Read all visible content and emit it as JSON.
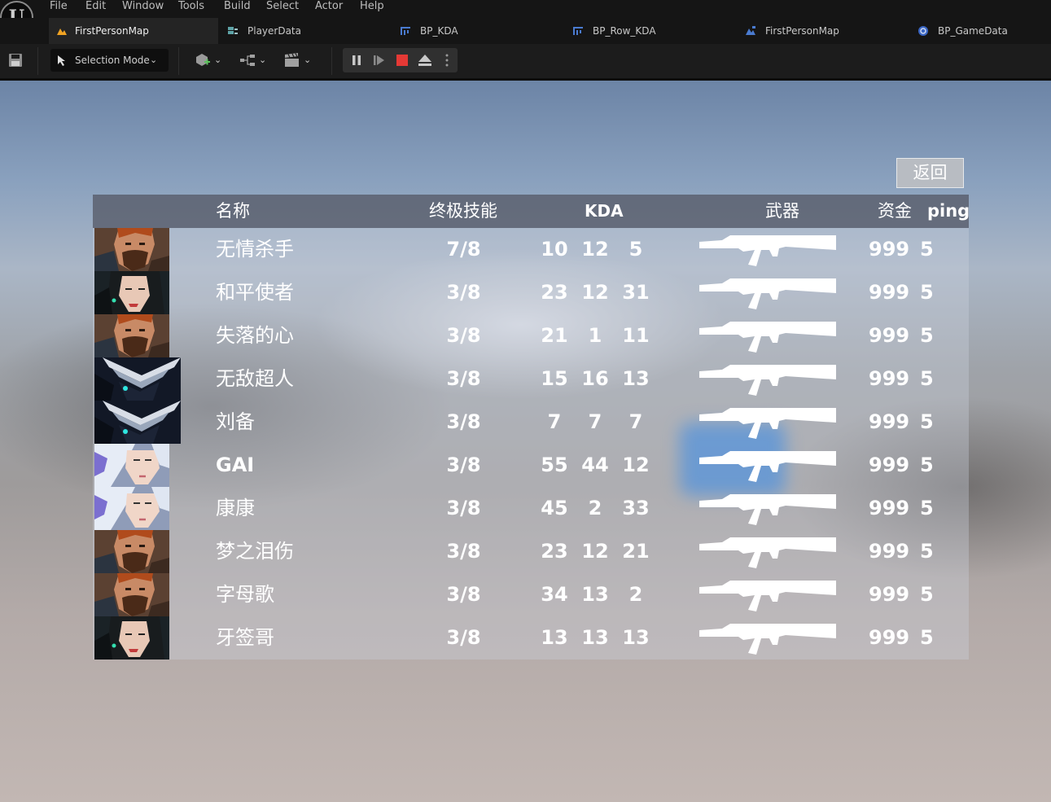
{
  "app": {
    "logo": "U",
    "menu": [
      "File",
      "Edit",
      "Window",
      "Tools",
      "Build",
      "Select",
      "Actor",
      "Help"
    ],
    "tabs": [
      {
        "label": "FirstPersonMap",
        "icon": "level-icon",
        "active": true
      },
      {
        "label": "PlayerData",
        "icon": "data-table-icon",
        "active": false
      },
      {
        "label": "BP_KDA",
        "icon": "widget-blueprint-icon",
        "active": false
      },
      {
        "label": "BP_Row_KDA",
        "icon": "widget-blueprint-icon",
        "active": false
      },
      {
        "label": "FirstPersonMap",
        "icon": "level-blueprint-icon",
        "active": false
      },
      {
        "label": "BP_GameData",
        "icon": "blueprint-icon",
        "active": false
      }
    ],
    "toolbar": {
      "selection_mode": "Selection Mode",
      "icons": [
        "save-icon",
        "add-actor-icon",
        "blueprint-options-icon",
        "cinematics-icon",
        "pause-icon",
        "step-frame-icon",
        "stop-icon",
        "eject-icon",
        "more-options-icon"
      ]
    }
  },
  "scoreboard": {
    "back_button": "返回",
    "headers": {
      "name": "名称",
      "ultimate": "终极技能",
      "kda": "KDA",
      "weapon": "武器",
      "money": "资金",
      "ping": "ping"
    },
    "players": [
      {
        "avatar": "bearded-man",
        "name": "无情杀手",
        "ultimate": "7/8",
        "kills": "10",
        "deaths": "12",
        "assists": "5",
        "money": "999",
        "ping": "5"
      },
      {
        "avatar": "woman-dark-hair",
        "name": "和平使者",
        "ultimate": "3/8",
        "kills": "23",
        "deaths": "12",
        "assists": "31",
        "money": "999",
        "ping": "5"
      },
      {
        "avatar": "bearded-man",
        "name": "失落的心",
        "ultimate": "3/8",
        "kills": "21",
        "deaths": "1",
        "assists": "11",
        "money": "999",
        "ping": "5"
      },
      {
        "avatar": "armored-knight",
        "name": "无敌超人",
        "ultimate": "3/8",
        "kills": "15",
        "deaths": "16",
        "assists": "13",
        "money": "999",
        "ping": "5"
      },
      {
        "avatar": "armored-knight",
        "name": "刘备",
        "ultimate": "3/8",
        "kills": "7",
        "deaths": "7",
        "assists": "7",
        "money": "999",
        "ping": "5"
      },
      {
        "avatar": "woman-white-hair",
        "name": "GAI",
        "ultimate": "3/8",
        "kills": "55",
        "deaths": "44",
        "assists": "12",
        "money": "999",
        "ping": "5"
      },
      {
        "avatar": "woman-white-hair",
        "name": "康康",
        "ultimate": "3/8",
        "kills": "45",
        "deaths": "2",
        "assists": "33",
        "money": "999",
        "ping": "5"
      },
      {
        "avatar": "bearded-man",
        "name": "梦之泪伤",
        "ultimate": "3/8",
        "kills": "23",
        "deaths": "12",
        "assists": "21",
        "money": "999",
        "ping": "5"
      },
      {
        "avatar": "bearded-man",
        "name": "字母歌",
        "ultimate": "3/8",
        "kills": "34",
        "deaths": "13",
        "assists": "2",
        "money": "999",
        "ping": "5"
      },
      {
        "avatar": "woman-dark-hair",
        "name": "牙签哥",
        "ultimate": "3/8",
        "kills": "13",
        "deaths": "13",
        "assists": "13",
        "money": "999",
        "ping": "5"
      }
    ]
  },
  "colors": {
    "editor_bg": "#151515",
    "accent_orange": "#f0a323",
    "stop_red": "#e53935",
    "blueprint_blue": "#4a7bd0"
  }
}
